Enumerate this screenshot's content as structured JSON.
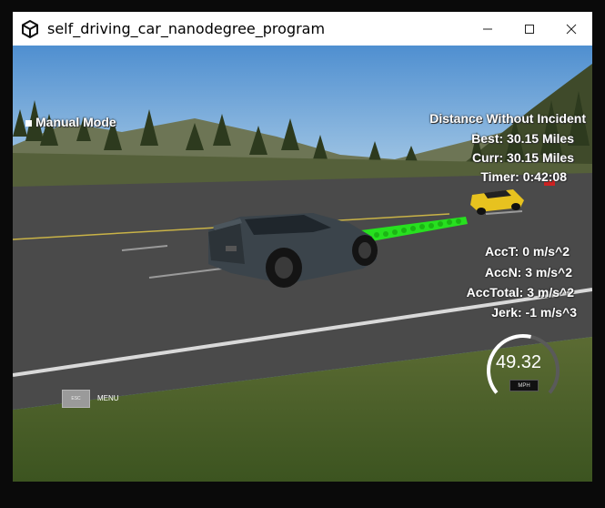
{
  "window": {
    "title": "self_driving_car_nanodegree_program"
  },
  "hud": {
    "mode": "Manual Mode",
    "distance_title": "Distance Without Incident",
    "best": "Best: 30.15 Miles",
    "curr": "Curr: 30.15 Miles",
    "timer": "Timer: 0:42:08",
    "acct": "AccT: 0 m/s^2",
    "accn": "AccN: 3 m/s^2",
    "acctotal": "AccTotal: 3 m/s^2",
    "jerk": "Jerk: -1 m/s^3"
  },
  "menu": {
    "button_label": "ESC",
    "label": "MENU"
  },
  "speedometer": {
    "value": "49.32",
    "unit": "MPH",
    "fill_fraction": 0.55
  },
  "colors": {
    "path": "#27e01f",
    "sky": "#6ea7d8",
    "road": "#4a4a4a",
    "grass": "#4f6a2a"
  },
  "icons": {
    "app": "unity-icon",
    "minimize": "minimize-icon",
    "maximize": "maximize-icon",
    "close": "close-icon"
  }
}
